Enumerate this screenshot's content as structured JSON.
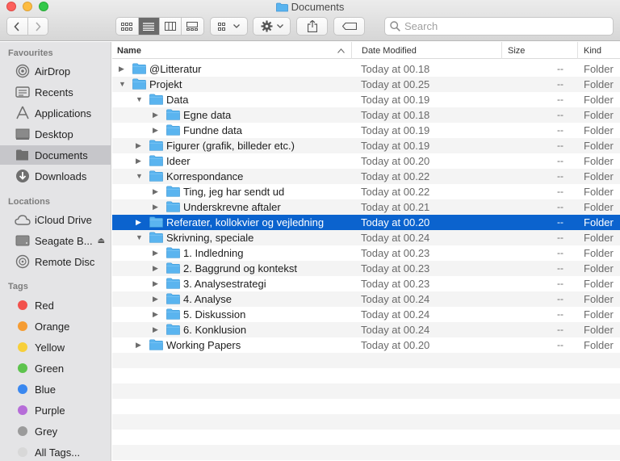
{
  "window": {
    "title": "Documents"
  },
  "toolbar": {
    "search_placeholder": "Search"
  },
  "sidebar": {
    "sections": [
      {
        "heading": "Favourites",
        "items": [
          {
            "label": "AirDrop",
            "icon": "airdrop-icon"
          },
          {
            "label": "Recents",
            "icon": "recents-icon"
          },
          {
            "label": "Applications",
            "icon": "applications-icon"
          },
          {
            "label": "Desktop",
            "icon": "desktop-icon"
          },
          {
            "label": "Documents",
            "icon": "documents-icon",
            "active": true
          },
          {
            "label": "Downloads",
            "icon": "downloads-icon"
          }
        ]
      },
      {
        "heading": "Locations",
        "items": [
          {
            "label": "iCloud Drive",
            "icon": "cloud-icon"
          },
          {
            "label": "Seagate B...",
            "icon": "drive-icon"
          },
          {
            "label": "Remote Disc",
            "icon": "disc-icon"
          }
        ]
      },
      {
        "heading": "Tags",
        "items": [
          {
            "label": "Red",
            "color": "#f2514c"
          },
          {
            "label": "Orange",
            "color": "#f59c33"
          },
          {
            "label": "Yellow",
            "color": "#f7cf3a"
          },
          {
            "label": "Green",
            "color": "#5dc34d"
          },
          {
            "label": "Blue",
            "color": "#3a88f0"
          },
          {
            "label": "Purple",
            "color": "#b66dd8"
          },
          {
            "label": "Grey",
            "color": "#9b9b9b"
          },
          {
            "label": "All Tags...",
            "color": "#d8d8d8"
          }
        ]
      }
    ]
  },
  "columns": {
    "name": "Name",
    "date": "Date Modified",
    "size": "Size",
    "kind": "Kind"
  },
  "rows": [
    {
      "name": "@Litteratur",
      "level": 0,
      "expanded": false,
      "date": "Today at 00.18",
      "size": "--",
      "kind": "Folder"
    },
    {
      "name": "Projekt",
      "level": 0,
      "expanded": true,
      "date": "Today at 00.25",
      "size": "--",
      "kind": "Folder"
    },
    {
      "name": "Data",
      "level": 1,
      "expanded": true,
      "date": "Today at 00.19",
      "size": "--",
      "kind": "Folder"
    },
    {
      "name": "Egne data",
      "level": 2,
      "expanded": false,
      "date": "Today at 00.18",
      "size": "--",
      "kind": "Folder"
    },
    {
      "name": "Fundne data",
      "level": 2,
      "expanded": false,
      "date": "Today at 00.19",
      "size": "--",
      "kind": "Folder"
    },
    {
      "name": "Figurer (grafik, billeder etc.)",
      "level": 1,
      "expanded": false,
      "date": "Today at 00.19",
      "size": "--",
      "kind": "Folder"
    },
    {
      "name": "Ideer",
      "level": 1,
      "expanded": false,
      "date": "Today at 00.20",
      "size": "--",
      "kind": "Folder"
    },
    {
      "name": "Korrespondance",
      "level": 1,
      "expanded": true,
      "date": "Today at 00.22",
      "size": "--",
      "kind": "Folder"
    },
    {
      "name": "Ting, jeg har sendt ud",
      "level": 2,
      "expanded": false,
      "date": "Today at 00.22",
      "size": "--",
      "kind": "Folder"
    },
    {
      "name": "Underskrevne aftaler",
      "level": 2,
      "expanded": false,
      "date": "Today at 00.21",
      "size": "--",
      "kind": "Folder"
    },
    {
      "name": "Referater, kollokvier og vejledning",
      "level": 1,
      "expanded": false,
      "selected": true,
      "date": "Today at 00.20",
      "size": "--",
      "kind": "Folder"
    },
    {
      "name": "Skrivning, speciale",
      "level": 1,
      "expanded": true,
      "date": "Today at 00.24",
      "size": "--",
      "kind": "Folder"
    },
    {
      "name": "1. Indledning",
      "level": 2,
      "expanded": false,
      "date": "Today at 00.23",
      "size": "--",
      "kind": "Folder"
    },
    {
      "name": "2. Baggrund og kontekst",
      "level": 2,
      "expanded": false,
      "date": "Today at 00.23",
      "size": "--",
      "kind": "Folder"
    },
    {
      "name": "3. Analysestrategi",
      "level": 2,
      "expanded": false,
      "date": "Today at 00.23",
      "size": "--",
      "kind": "Folder"
    },
    {
      "name": "4. Analyse",
      "level": 2,
      "expanded": false,
      "date": "Today at 00.24",
      "size": "--",
      "kind": "Folder"
    },
    {
      "name": "5. Diskussion",
      "level": 2,
      "expanded": false,
      "date": "Today at 00.24",
      "size": "--",
      "kind": "Folder"
    },
    {
      "name": "6. Konklusion",
      "level": 2,
      "expanded": false,
      "date": "Today at 00.24",
      "size": "--",
      "kind": "Folder"
    },
    {
      "name": "Working Papers",
      "level": 1,
      "expanded": false,
      "date": "Today at 00.20",
      "size": "--",
      "kind": "Folder"
    }
  ],
  "colors": {
    "selection": "#0b63ce",
    "folder": "#5ab4ef"
  }
}
